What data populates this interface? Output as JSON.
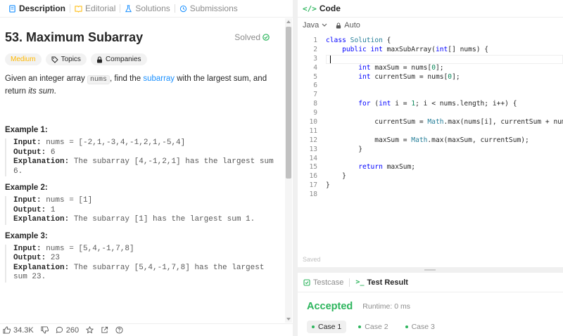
{
  "left_tabs": [
    {
      "label": "Description"
    },
    {
      "label": "Editorial"
    },
    {
      "label": "Solutions"
    },
    {
      "label": "Submissions"
    }
  ],
  "problem": {
    "title": "53. Maximum Subarray",
    "solved_label": "Solved",
    "tags": {
      "difficulty": "Medium",
      "topics": "Topics",
      "companies": "Companies"
    },
    "statement": {
      "part1": "Given an integer array ",
      "code": "nums",
      "part2": ", find the ",
      "link": "subarray",
      "part3": " with the largest sum, and return ",
      "italic": "its sum",
      "part4": "."
    },
    "examples": [
      {
        "title": "Example 1:",
        "input_label": "Input:",
        "input": " nums = [-2,1,-3,4,-1,2,1,-5,4]",
        "output_label": "Output:",
        "output": " 6",
        "explanation_label": "Explanation:",
        "explanation": " The subarray [4,-1,2,1] has the largest sum 6."
      },
      {
        "title": "Example 2:",
        "input_label": "Input:",
        "input": " nums = [1]",
        "output_label": "Output:",
        "output": " 1",
        "explanation_label": "Explanation:",
        "explanation": " The subarray [1] has the largest sum 1."
      },
      {
        "title": "Example 3:",
        "input_label": "Input:",
        "input": " nums = [5,4,-1,7,8]",
        "output_label": "Output:",
        "output": " 23",
        "explanation_label": "Explanation:",
        "explanation": " The subarray [5,4,-1,7,8] has the largest sum 23."
      }
    ]
  },
  "footer": {
    "likes": "34.3K",
    "comments": "260"
  },
  "code_panel": {
    "title": "Code",
    "language": "Java",
    "mode": "Auto",
    "saved_label": "Saved",
    "lines": [
      {
        "n": "1",
        "t": "class Solution {"
      },
      {
        "n": "2",
        "t": "    public int maxSubArray(int[] nums) {"
      },
      {
        "n": "3",
        "t": ""
      },
      {
        "n": "4",
        "t": "        int maxSum = nums[0];"
      },
      {
        "n": "5",
        "t": "        int currentSum = nums[0];"
      },
      {
        "n": "6",
        "t": ""
      },
      {
        "n": "7",
        "t": ""
      },
      {
        "n": "8",
        "t": "        for (int i = 1; i < nums.length; i++) {"
      },
      {
        "n": "9",
        "t": ""
      },
      {
        "n": "10",
        "t": "            currentSum = Math.max(nums[i], currentSum + nums[i]);"
      },
      {
        "n": "11",
        "t": ""
      },
      {
        "n": "12",
        "t": "            maxSum = Math.max(maxSum, currentSum);"
      },
      {
        "n": "13",
        "t": "        }"
      },
      {
        "n": "14",
        "t": ""
      },
      {
        "n": "15",
        "t": "        return maxSum;"
      },
      {
        "n": "16",
        "t": "    }"
      },
      {
        "n": "17",
        "t": "}"
      },
      {
        "n": "18",
        "t": ""
      }
    ]
  },
  "bottom_panel": {
    "tabs": [
      {
        "label": "Testcase"
      },
      {
        "label": "Test Result"
      }
    ],
    "status": "Accepted",
    "runtime": "Runtime: 0 ms",
    "cases": [
      {
        "label": "Case 1"
      },
      {
        "label": "Case 2"
      },
      {
        "label": "Case 3"
      }
    ]
  },
  "colors": {
    "accent_green": "#2db55d",
    "medium": "#ffb800",
    "link": "#1a90ff"
  }
}
